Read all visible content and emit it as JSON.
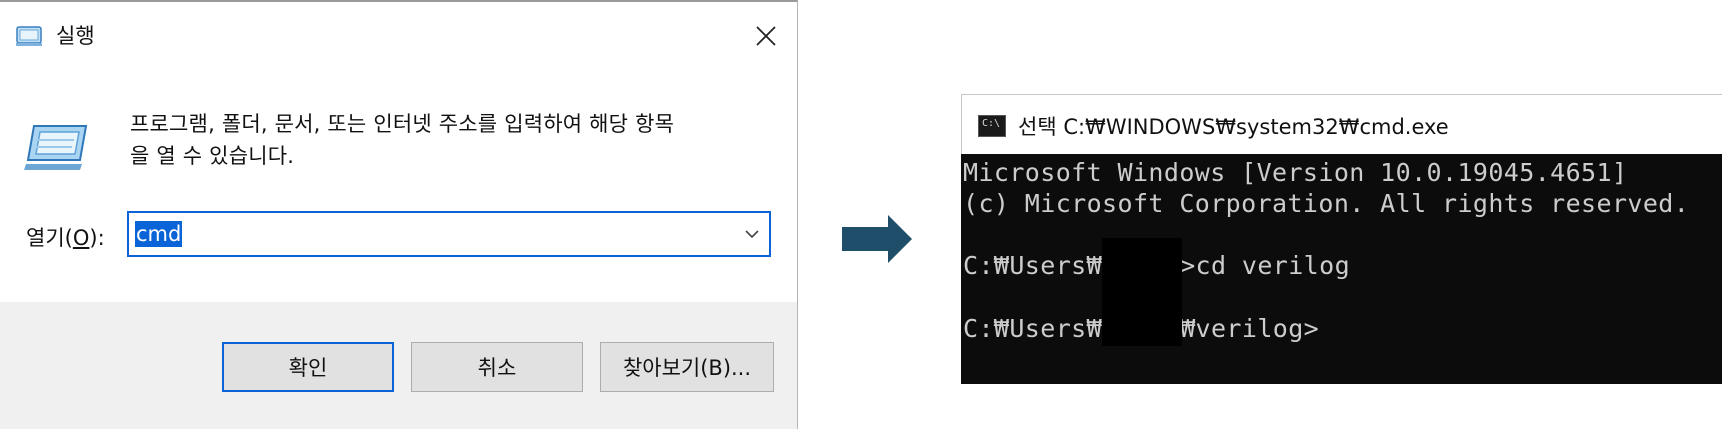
{
  "run_dialog": {
    "title": "실행",
    "description_line1": "프로그램, 폴더, 문서, 또는 인터넷 주소를 입력하여 해당 항목",
    "description_line2": "을 열 수 있습니다.",
    "open_label_prefix": "열기(",
    "open_label_mnemonic": "O",
    "open_label_suffix": "):",
    "open_input_value": "cmd",
    "buttons": {
      "ok": "확인",
      "cancel": "취소",
      "browse": "찾아보기(B)..."
    },
    "icons": [
      "run-icon",
      "close-icon",
      "chevron-down-icon"
    ]
  },
  "arrow": {
    "color": "#1f4e6b",
    "direction": "right"
  },
  "cmd_window": {
    "title": "선택 C:₩WINDOWS₩system32₩cmd.exe",
    "console": {
      "banner_line1": "Microsoft Windows [Version 10.0.19045.4651]",
      "banner_line2": "(c) Microsoft Corporation. All rights reserved.",
      "line_cd_prefix": "C:₩Users₩",
      "line_cd_suffix": ">cd verilog",
      "line_prompt_prefix": "C:₩Users₩",
      "line_prompt_suffix": "₩verilog>"
    },
    "colors": {
      "console_bg": "#0c0c0c",
      "console_text": "#cccccc"
    }
  },
  "colors": {
    "accent": "#0a64d8",
    "dialog_bg": "#f0f0f0"
  }
}
